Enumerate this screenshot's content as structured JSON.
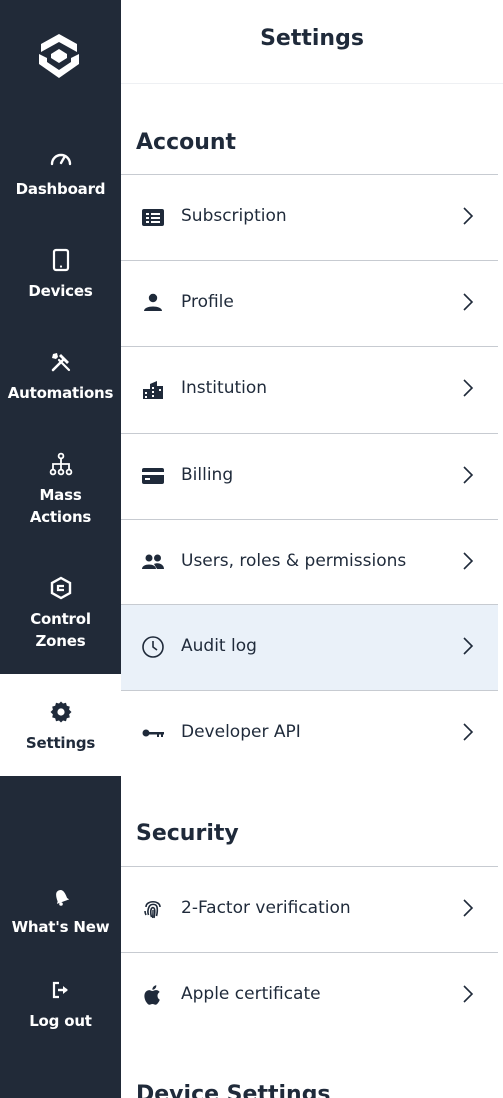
{
  "sidebar": {
    "items": [
      {
        "label": "Dashboard",
        "icon": "gauge-icon"
      },
      {
        "label": "Devices",
        "icon": "tablet-icon"
      },
      {
        "label": "Automations",
        "icon": "tools-icon"
      },
      {
        "label": "Mass\nActions",
        "icon": "hierarchy-icon"
      },
      {
        "label": "Control\nZones",
        "icon": "zone-icon"
      },
      {
        "label": "Settings",
        "icon": "gear-icon",
        "active": true
      },
      {
        "label": "What's New",
        "icon": "bell-icon"
      },
      {
        "label": "Log out",
        "icon": "logout-icon"
      }
    ]
  },
  "header": {
    "title": "Settings"
  },
  "sections": {
    "account": {
      "title": "Account",
      "items": [
        {
          "label": "Subscription",
          "icon": "list-card-icon"
        },
        {
          "label": "Profile",
          "icon": "person-icon"
        },
        {
          "label": "Institution",
          "icon": "building-icon"
        },
        {
          "label": "Billing",
          "icon": "credit-card-icon"
        },
        {
          "label": "Users, roles & permissions",
          "icon": "users-icon"
        },
        {
          "label": "Audit log",
          "icon": "clock-icon",
          "highlighted": true
        },
        {
          "label": "Developer API",
          "icon": "key-icon"
        }
      ]
    },
    "security": {
      "title": "Security",
      "items": [
        {
          "label": "2-Factor verification",
          "icon": "fingerprint-icon"
        },
        {
          "label": "Apple certificate",
          "icon": "apple-icon"
        }
      ]
    },
    "device_settings": {
      "title": "Device Settings"
    }
  },
  "colors": {
    "sidebar_bg": "#212a38",
    "text": "#1f2a3a",
    "highlight_bg": "#eaf1f9",
    "divider": "#c7cbd1"
  }
}
